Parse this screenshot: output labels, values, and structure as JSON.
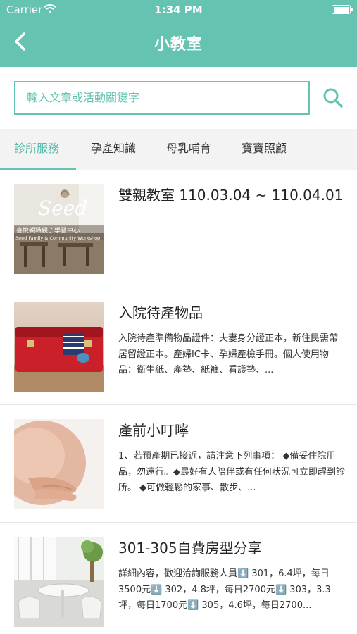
{
  "status_bar": {
    "carrier": "Carrier",
    "time": "1:34 PM"
  },
  "header": {
    "title": "小教室",
    "back_icon": "chevron-left-icon",
    "color": "#64c3b1"
  },
  "search": {
    "placeholder": "輸入文章或活動關鍵字",
    "icon": "search-icon"
  },
  "tabs": [
    {
      "label": "診所服務",
      "active": true
    },
    {
      "label": "孕產知識",
      "active": false
    },
    {
      "label": "母乳哺育",
      "active": false
    },
    {
      "label": "寶寶照顧",
      "active": false
    }
  ],
  "articles": [
    {
      "title": "雙親教室 110.03.04 ~ 110.04.01",
      "description": "",
      "thumb_label": "Seed",
      "thumb_sub": "喜悅親職親子學習中心",
      "thumb_caption": "Seed Family & Community Workshop"
    },
    {
      "title": "入院待產物品",
      "description": "入院待產準備物品證件：夫妻身分證正本，新住民需帶居留證正本。產婦IC卡、孕婦產檢手冊。個人使用物品：衛生紙、產墊、紙褲、看護墊、..."
    },
    {
      "title": "產前小叮嚀",
      "description": "1、若預產期已接近，請注意下列事項： ◆備妥住院用品，勿遠行。◆最好有人陪伴或有任何狀況可立即趕到診所。 ◆可做輕鬆的家事、散步、..."
    },
    {
      "title": "301-305自費房型分享",
      "description": "詳細內容，歡迎洽詢服務人員⬇️ 301，6.4坪，每日3500元⬇️ 302，4.8坪，每日2700元⬇️ 303，3.3坪，每日1700元⬇️ 305，4.6坪，每日2700..."
    }
  ]
}
